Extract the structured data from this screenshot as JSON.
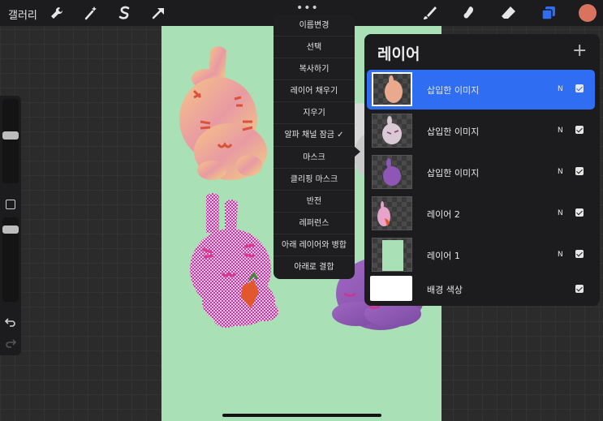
{
  "topbar": {
    "gallery_label": "갤러리",
    "left_tools": [
      "wrench-icon",
      "magic-wand-icon",
      "selection-s-icon",
      "arrow-transform-icon"
    ],
    "right_tools": [
      "brush-icon",
      "smudge-icon",
      "eraser-icon",
      "layers-icon"
    ],
    "color_swatch": "#d9725f",
    "accent": "#2f6df2"
  },
  "menu": {
    "items": [
      "이름변경",
      "선택",
      "복사하기",
      "레이어 채우기",
      "지우기",
      "알파 채널 잠금 ✓",
      "마스크",
      "클리핑 마스크",
      "반전",
      "레퍼런스",
      "아래 레이어와 병합",
      "아래로 결합"
    ]
  },
  "layers": {
    "title": "레이어",
    "add_label": "+",
    "rows": [
      {
        "name": "삽입한 이미지",
        "blend": "N",
        "visible": true,
        "selected": true
      },
      {
        "name": "삽입한 이미지",
        "blend": "N",
        "visible": true,
        "selected": false
      },
      {
        "name": "삽입한 이미지",
        "blend": "N",
        "visible": true,
        "selected": false
      },
      {
        "name": "레이어 2",
        "blend": "N",
        "visible": true,
        "selected": false
      },
      {
        "name": "레이어 1",
        "blend": "N",
        "visible": true,
        "selected": false
      },
      {
        "name": "배경 색상",
        "blend": "",
        "visible": true,
        "selected": false
      }
    ]
  },
  "canvas": {
    "background": "#a9e0b6"
  }
}
